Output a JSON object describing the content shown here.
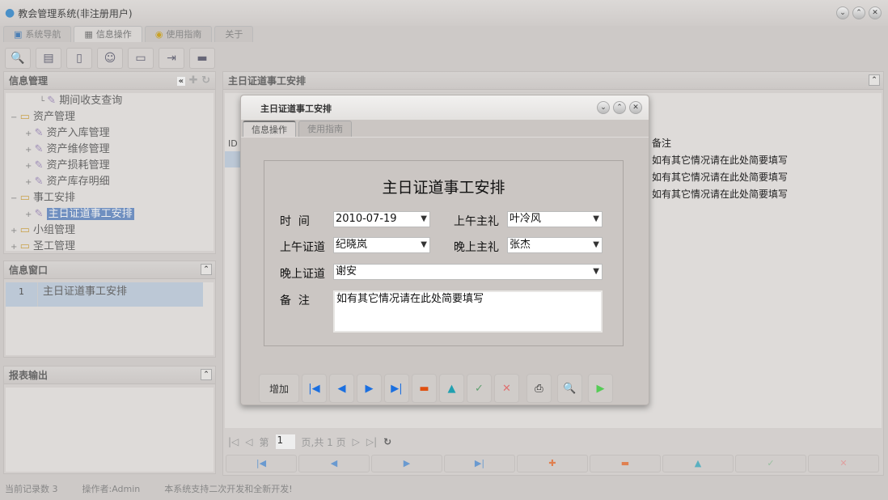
{
  "app": {
    "title": "教会管理系统(非注册用户)"
  },
  "tabs": [
    {
      "label": "系统导航",
      "icon": "monitor-icon"
    },
    {
      "label": "信息操作",
      "icon": "grid-icon"
    },
    {
      "label": "使用指南",
      "icon": "help-icon"
    },
    {
      "label": "关于"
    }
  ],
  "toolbar": [
    "search-doc-icon",
    "list-icon",
    "document-icon",
    "user-computer-icon",
    "screen-globe-icon",
    "export-icon",
    "window-icon"
  ],
  "left": {
    "info_mgmt": {
      "title": "信息管理",
      "tree": [
        {
          "label": "期间收支查询",
          "level": 2
        },
        {
          "label": "资产管理",
          "level": 0,
          "folder": true
        },
        {
          "label": "资产入库管理",
          "level": 1
        },
        {
          "label": "资产维修管理",
          "level": 1
        },
        {
          "label": "资产损耗管理",
          "level": 1
        },
        {
          "label": "资产库存明细",
          "level": 1
        },
        {
          "label": "事工安排",
          "level": 0,
          "folder": true
        },
        {
          "label": "主日证道事工安排",
          "level": 1,
          "selected": true
        },
        {
          "label": "小组管理",
          "level": 0,
          "folder": true,
          "collapsed": true
        },
        {
          "label": "圣工管理",
          "level": 0,
          "folder": true,
          "collapsed": true
        }
      ]
    },
    "info_window": {
      "title": "信息窗口",
      "rows": [
        {
          "no": "1",
          "label": "主日证道事工安排"
        }
      ]
    },
    "report": {
      "title": "报表输出"
    }
  },
  "main": {
    "title": "主日证道事工安排",
    "grid": {
      "col_id": "ID",
      "col_note": "备注",
      "notes": [
        "如有其它情况请在此处简要填写",
        "如有其它情况请在此处简要填写",
        "如有其它情况请在此处简要填写"
      ]
    },
    "pager": {
      "page_prefix": "第",
      "page": "1",
      "page_suffix": "页,共 1 页"
    }
  },
  "status": {
    "records": "当前记录数 3",
    "operator": "操作者:Admin",
    "message": "本系统支持二次开发和全新开发!"
  },
  "modal": {
    "title": "主日证道事工安排",
    "tabs": [
      "信息操作",
      "使用指南"
    ],
    "form_title": "主日证道事工安排",
    "fields": {
      "time_label": "时  间",
      "time": "2010-07-19",
      "am_host_label": "上午主礼",
      "am_host": "叶冷风",
      "am_preach_label": "上午证道",
      "am_preach": "纪晓岚",
      "pm_host_label": "晚上主礼",
      "pm_host": "张杰",
      "pm_preach_label": "晚上证道",
      "pm_preach": "谢安",
      "note_label": "备  注",
      "note": "如有其它情况请在此处简要填写"
    },
    "add_label": "增加"
  }
}
